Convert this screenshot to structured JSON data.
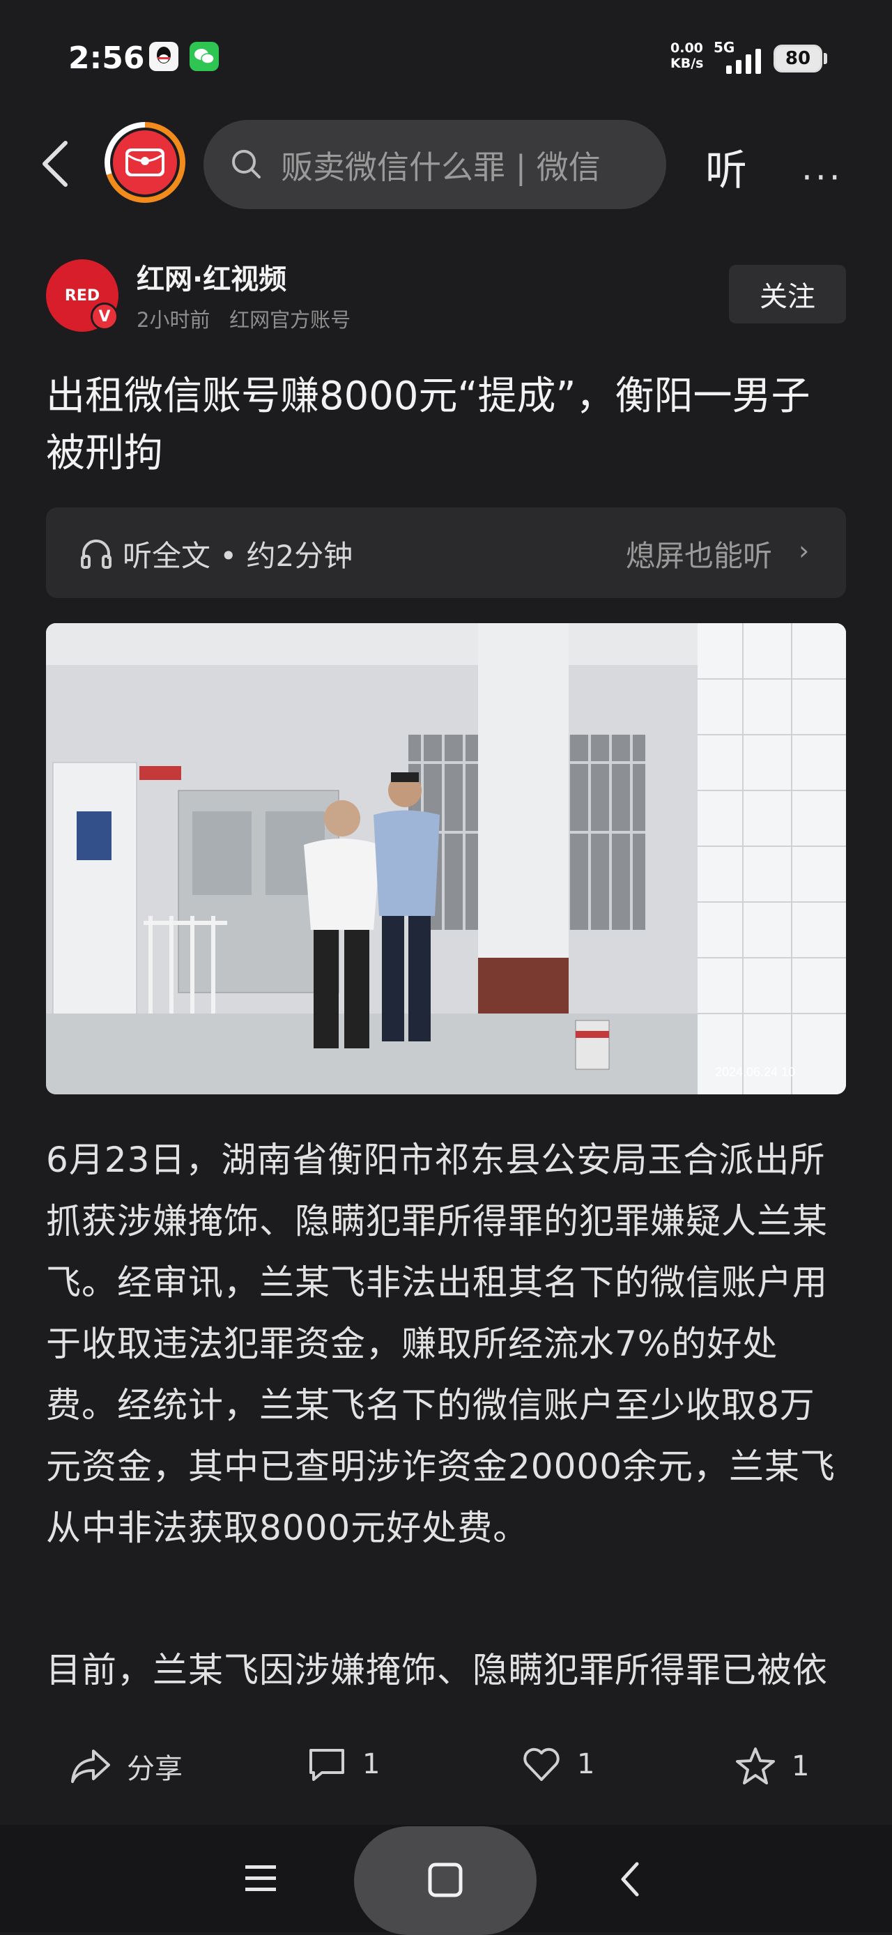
{
  "status_bar": {
    "time": "2:56",
    "net_speed_value": "0.00",
    "net_speed_unit": "KB/s",
    "network": "5G",
    "battery": "80"
  },
  "top_nav": {
    "search_placeholder": "贩卖微信什么罪 | 微信",
    "listen_label": "听",
    "more_label": "···"
  },
  "author": {
    "avatar_text": "RED",
    "badge": "V",
    "name": "红网·红视频",
    "time_ago": "2小时前",
    "account_type": "红网官方账号",
    "follow_label": "关注"
  },
  "article": {
    "title": "出租微信账号赚8000元“提成”，衡阳一男子被刑拘",
    "audio_label": "听全文 • 约2分钟",
    "audio_right": "熄屏也能听",
    "photo_timestamp": "2024.06.24 10",
    "paragraph_1": "6月23日，湖南省衡阳市祁东县公安局玉合派出所抓获涉嫌掩饰、隐瞒犯罪所得罪的犯罪嫌疑人兰某飞。经审讯，兰某飞非法出租其名下的微信账户用于收取违法犯罪资金，赚取所经流水7%的好处费。经统计，兰某飞名下的微信账户至少收取8万元资金，其中已查明涉诈资金20000余元，兰某飞从中非法获取8000元好处费。",
    "paragraph_2": "目前，兰某飞因涉嫌掩饰、隐瞒犯罪所得罪已被依法刑事拘留。"
  },
  "actions": {
    "share_label": "分享",
    "comment_count": "1",
    "like_count": "1",
    "favorite_count": "1"
  },
  "colors": {
    "background": "#1c1c1e",
    "accent_red": "#e8303a",
    "accent_orange": "#f28a1c"
  }
}
